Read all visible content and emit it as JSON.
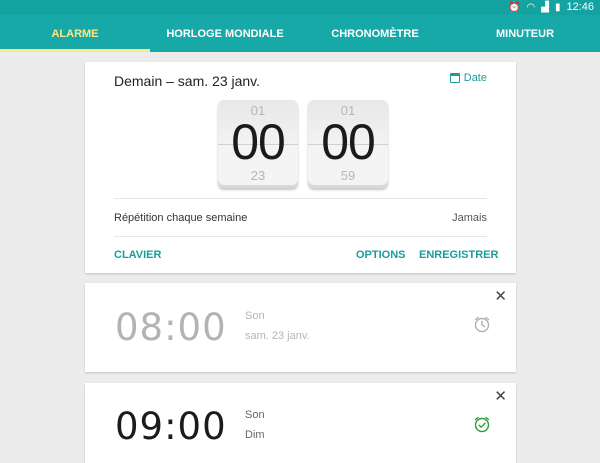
{
  "status_bar": {
    "time": "12:46",
    "icons": [
      "alarm-icon",
      "wifi-icon",
      "signal-icon",
      "battery-icon"
    ]
  },
  "tabs": [
    {
      "label": "ALARME",
      "active": true
    },
    {
      "label": "HORLOGE MONDIALE",
      "active": false
    },
    {
      "label": "CHRONOMÈTRE",
      "active": false
    },
    {
      "label": "MINUTEUR",
      "active": false
    }
  ],
  "editor": {
    "title": "Demain – sam. 23 janv.",
    "date_label": "Date",
    "hour": {
      "prev": "01",
      "value": "00",
      "next": "23"
    },
    "minute": {
      "prev": "01",
      "value": "00",
      "next": "59"
    },
    "repeat_label": "Répétition chaque semaine",
    "repeat_value": "Jamais",
    "actions": {
      "keyboard": "CLAVIER",
      "options": "OPTIONS",
      "save": "ENREGISTRER"
    }
  },
  "alarms": [
    {
      "time": "08:00",
      "sound": "Son",
      "when": "sam. 23 janv.",
      "enabled": false
    },
    {
      "time": "09:00",
      "sound": "Son",
      "when": "Dim",
      "enabled": true
    }
  ],
  "colors": {
    "teal": "#17a9a7",
    "accent_tab": "#ffe680",
    "action_text": "#1a9d9b",
    "enabled_icon": "#2e9e3a",
    "disabled_icon": "#b0b0b0"
  }
}
